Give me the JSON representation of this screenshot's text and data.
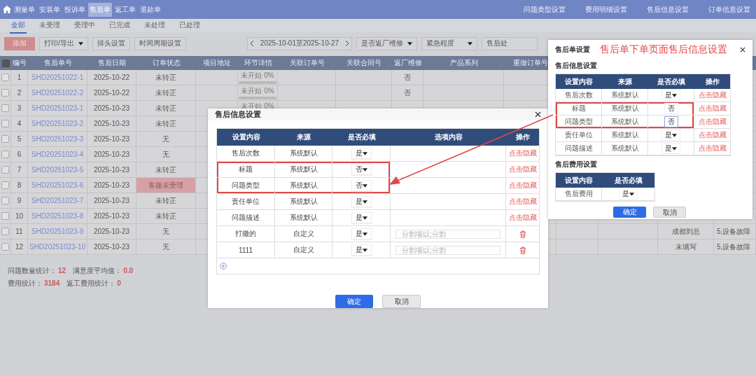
{
  "nav": {
    "items": [
      {
        "label": "测量单",
        "selected": false
      },
      {
        "label": "安装单",
        "selected": false
      },
      {
        "label": "投诉单",
        "selected": false
      },
      {
        "label": "售后单",
        "selected": true
      },
      {
        "label": "返工单",
        "selected": false
      },
      {
        "label": "退款单",
        "selected": false
      }
    ],
    "links": [
      "问题类型设置",
      "费用明细设置",
      "售后信息设置",
      "订单信息设置"
    ]
  },
  "tabs": [
    {
      "label": "全部",
      "selected": true
    },
    {
      "label": "未受理",
      "selected": false
    },
    {
      "label": "受理中",
      "selected": false
    },
    {
      "label": "已完成",
      "selected": false
    },
    {
      "label": "未处理",
      "selected": false
    },
    {
      "label": "已处理",
      "selected": false
    }
  ],
  "toolbar": {
    "add": "添加",
    "export": "打印/导出",
    "header_settings": "排头设置",
    "period_settings": "时间周期设置",
    "date_range": "2025-10-01至2025-10-27",
    "filters": [
      "是否返厂维修",
      "紧急程度"
    ],
    "cut_filter": "售后处"
  },
  "table": {
    "header_checked": true,
    "columns": [
      "编号",
      "售后单号",
      "售后日期",
      "订单状态",
      "项目地址",
      "环节详情",
      "关联订单号",
      "关联合同号",
      "返厂维修",
      "产品系列",
      "重做订单号"
    ],
    "rows": [
      {
        "checked": false,
        "no": "1",
        "order_no": "SHD20251022-1",
        "date": "2025-10-22",
        "status": "未转正",
        "status_alert": false,
        "progress": {
          "label": "未开始 0%",
          "level": 0
        },
        "return_repair": "否"
      },
      {
        "checked": false,
        "no": "2",
        "order_no": "SHD20251022-2",
        "date": "2025-10-22",
        "status": "未转正",
        "status_alert": false,
        "progress": {
          "label": "未开始 0%",
          "level": 0
        },
        "return_repair": "否"
      },
      {
        "checked": false,
        "no": "3",
        "order_no": "SHD20251023-1",
        "date": "2025-10-23",
        "status": "未转正",
        "status_alert": false,
        "progress": {
          "label": "未开始 0%",
          "level": 0
        }
      },
      {
        "checked": false,
        "no": "4",
        "order_no": "SHD20251023-2",
        "date": "2025-10-23",
        "status": "未转正",
        "status_alert": false
      },
      {
        "checked": false,
        "no": "5",
        "order_no": "SHD20251023-3",
        "date": "2025-10-23",
        "status": "无",
        "status_alert": false
      },
      {
        "checked": false,
        "no": "6",
        "order_no": "SHD20251023-4",
        "date": "2025-10-23",
        "status": "无",
        "status_alert": false
      },
      {
        "checked": false,
        "no": "7",
        "order_no": "SHD20251023-5",
        "date": "2025-10-23",
        "status": "未转正",
        "status_alert": false
      },
      {
        "checked": false,
        "no": "8",
        "order_no": "SHD20251023-6",
        "date": "2025-10-23",
        "status": "客服未受理",
        "status_alert": true
      },
      {
        "checked": false,
        "no": "9",
        "order_no": "SHD20251023-7",
        "date": "2025-10-23",
        "status": "未转正",
        "status_alert": false
      },
      {
        "checked": false,
        "no": "10",
        "order_no": "SHD20251023-8",
        "date": "2025-10-23",
        "status": "未转正",
        "status_alert": false
      },
      {
        "checked": false,
        "no": "11",
        "order_no": "SHD20251023-9",
        "date": "2025-10-23",
        "status": "无",
        "status_alert": false,
        "column_15": "成都刘总",
        "column_16": "5,设备故障"
      },
      {
        "checked": false,
        "no": "12",
        "order_no": "SHD20251023-10",
        "date": "2025-10-23",
        "status": "无",
        "status_alert": false,
        "column_15": "未填写",
        "column_16": "5,设备故障"
      }
    ]
  },
  "stats": [
    {
      "label": "问题数量统计：",
      "value": "12"
    },
    {
      "label": "满意度平均值：",
      "value": "0.0"
    },
    {
      "label": "费用统计：",
      "value": "3184"
    },
    {
      "label": "返工费用统计：",
      "value": "0"
    }
  ],
  "modal": {
    "title": "售后信息设置",
    "columns": [
      "设置内容",
      "来源",
      "是否必填",
      "选项内容",
      "操作"
    ],
    "rows": [
      {
        "kind": "system",
        "name": "售后次数",
        "source": "系统默认",
        "required": "是",
        "highlighted": false,
        "action": "点击隐藏"
      },
      {
        "kind": "system",
        "name": "标题",
        "source": "系统默认",
        "required": "否",
        "highlighted": true,
        "action": "点击隐藏"
      },
      {
        "kind": "system",
        "name": "问题类型",
        "source": "系统默认",
        "required": "否",
        "highlighted": true,
        "action": "点击隐藏"
      },
      {
        "kind": "system",
        "name": "责任单位",
        "source": "系统默认",
        "required": "是",
        "highlighted": false,
        "action": "点击隐藏"
      },
      {
        "kind": "system",
        "name": "问题描述",
        "source": "系统默认",
        "required": "是",
        "highlighted": false,
        "action": "点击隐藏"
      },
      {
        "kind": "custom",
        "name": "打撒的",
        "source": "自定义",
        "required": "是",
        "highlighted": false,
        "placeholder": "分割项以;分割"
      },
      {
        "kind": "custom",
        "name": "1111",
        "source": "自定义",
        "required": "是",
        "highlighted": false,
        "placeholder": "分割项以;分割"
      }
    ],
    "confirm": "确定",
    "cancel": "取消"
  },
  "panel": {
    "title": "售后单设置",
    "annotation": "售后单下单页面售后信息设置",
    "section_1": "售后信息设置",
    "columns": [
      "设置内容",
      "来源",
      "是否必填",
      "操作"
    ],
    "rows": [
      {
        "kind": "select",
        "name": "售后次数",
        "source": "系统默认",
        "required": "是",
        "focused": false,
        "highlighted": false,
        "action": "点击隐藏"
      },
      {
        "kind": "text",
        "name": "标题",
        "source": "系统默认",
        "required": "否",
        "focused": false,
        "highlighted": true,
        "action": "点击隐藏"
      },
      {
        "kind": "text",
        "name": "问题类型",
        "source": "系统默认",
        "required": "否",
        "focused": true,
        "highlighted": true,
        "action": "点击隐藏"
      },
      {
        "kind": "select",
        "name": "责任单位",
        "source": "系统默认",
        "required": "是",
        "focused": false,
        "highlighted": false,
        "action": "点击隐藏"
      },
      {
        "kind": "select",
        "name": "问题描述",
        "source": "系统默认",
        "required": "是",
        "focused": false,
        "highlighted": false,
        "action": "点击隐藏"
      }
    ],
    "section_2": "售后费用设置",
    "fee_columns": [
      "设置内容",
      "是否必填"
    ],
    "fee_rows": [
      {
        "name": "售后费用",
        "required": "是"
      }
    ],
    "confirm": "确定",
    "cancel": "取消"
  }
}
